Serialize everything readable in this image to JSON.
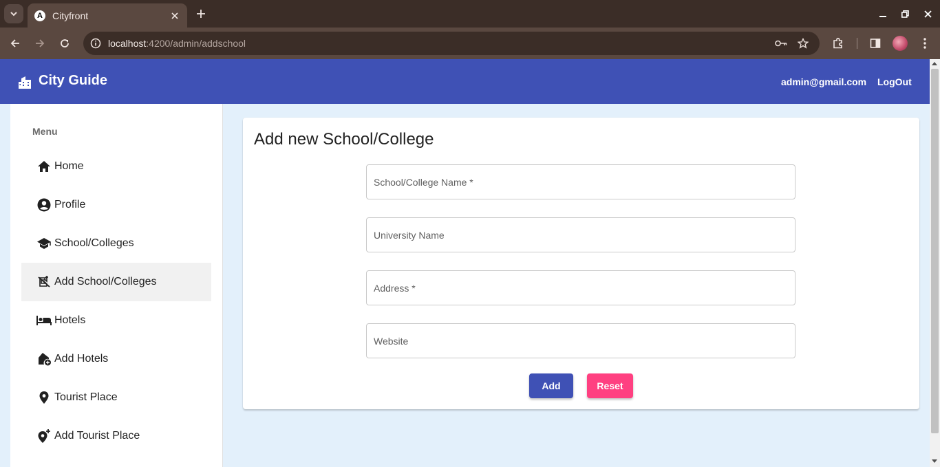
{
  "browser": {
    "tab_title": "Cityfront",
    "url_host": "localhost",
    "url_path": ":4200/admin/addschool",
    "frame_color": "#3b2d27",
    "toolbar_color": "#5a4840"
  },
  "header": {
    "brand": "City Guide",
    "user_email": "admin@gmail.com",
    "logout_label": "LogOut",
    "color": "#3f51b5"
  },
  "sidebar": {
    "menu_title": "Menu",
    "items": [
      {
        "label": "Home",
        "icon": "home-icon"
      },
      {
        "label": "Profile",
        "icon": "account-circle-icon"
      },
      {
        "label": "School/Colleges",
        "icon": "school-icon"
      },
      {
        "label": "Add School/Colleges",
        "icon": "add-school-icon",
        "active": true
      },
      {
        "label": "Hotels",
        "icon": "hotel-icon"
      },
      {
        "label": "Add Hotels",
        "icon": "add-home-icon"
      },
      {
        "label": "Tourist Place",
        "icon": "location-pin-icon"
      },
      {
        "label": "Add Tourist Place",
        "icon": "add-location-icon"
      }
    ]
  },
  "form": {
    "title": "Add new School/College",
    "fields": {
      "name": {
        "placeholder": "School/College Name *",
        "value": ""
      },
      "university": {
        "placeholder": "University Name",
        "value": ""
      },
      "address": {
        "placeholder": "Address *",
        "value": ""
      },
      "website": {
        "placeholder": "Website",
        "value": ""
      }
    },
    "add_label": "Add",
    "reset_label": "Reset",
    "add_color": "#3f51b5",
    "reset_color": "#ff4081"
  }
}
